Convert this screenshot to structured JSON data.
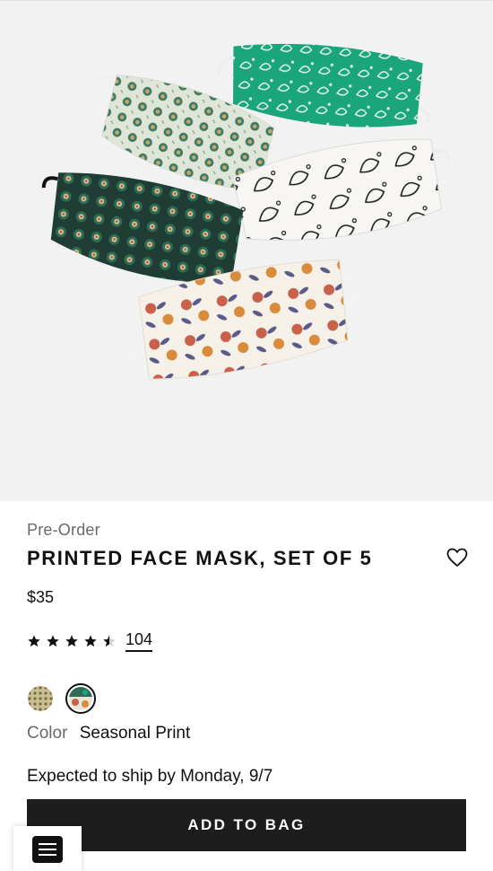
{
  "product": {
    "status": "Pre-Order",
    "title": "PRINTED FACE MASK, SET OF 5",
    "price": "$35",
    "rating": {
      "stars": 4.5,
      "max": 5,
      "review_count": "104"
    },
    "color": {
      "label": "Color",
      "value": "Seasonal Print",
      "selected_index": 1
    },
    "swatches": [
      "gold-dot-print",
      "seasonal-print"
    ],
    "shipping": "Expected to ship by Monday, 9/7",
    "cta": "ADD TO BAG"
  },
  "icons": {
    "wishlist": "heart-icon",
    "star": "star-icon",
    "chat": "chat-icon"
  },
  "colors": {
    "button_bg": "#1d1d1d",
    "hero_bg": "#f2f2f3",
    "muted_text": "#6a6a6a"
  }
}
